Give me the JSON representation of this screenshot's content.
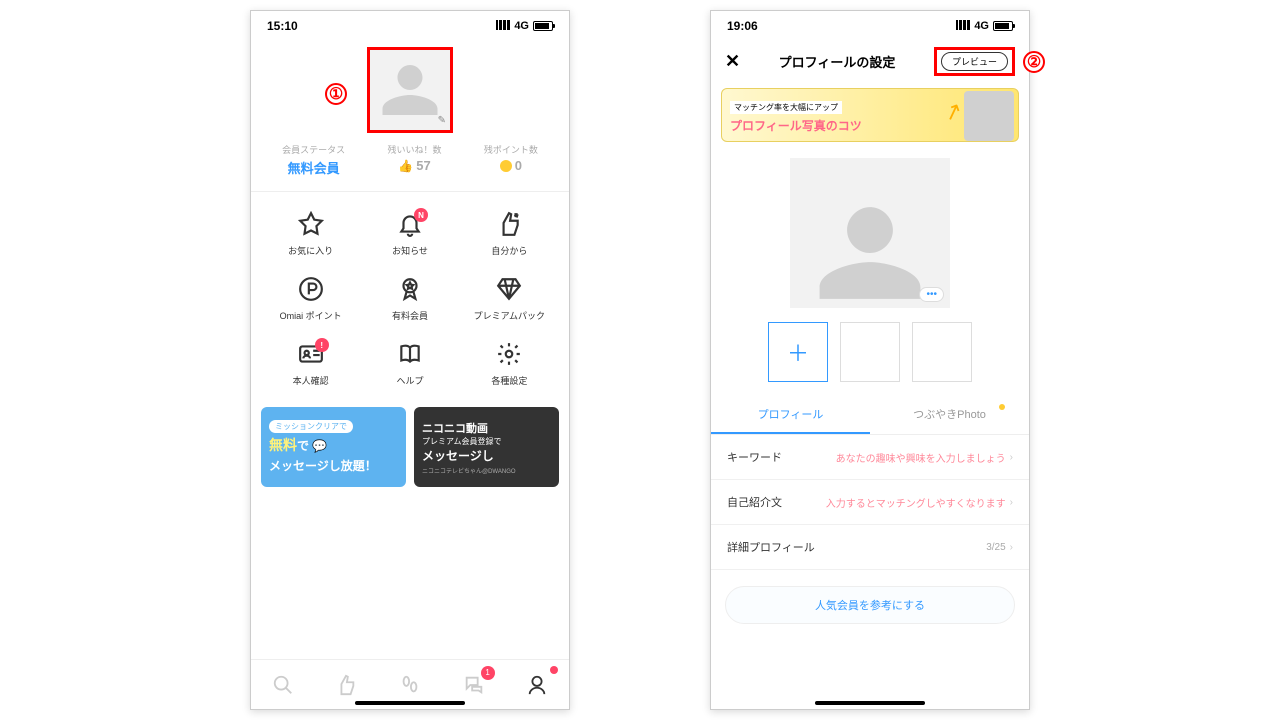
{
  "screen1": {
    "time": "15:10",
    "network": "4G",
    "annotation": "①",
    "stats": {
      "status_label": "会員ステータス",
      "status_value": "無料会員",
      "likes_label": "残いいね！数",
      "likes_value": "57",
      "points_label": "残ポイント数",
      "points_value": "0"
    },
    "menu": [
      {
        "label": "お気に入り",
        "icon": "star"
      },
      {
        "label": "お知らせ",
        "icon": "bell",
        "badge": "N"
      },
      {
        "label": "自分から",
        "icon": "thumbs-up-arrow"
      },
      {
        "label": "Omiai ポイント",
        "icon": "circle-p"
      },
      {
        "label": "有料会員",
        "icon": "medal"
      },
      {
        "label": "プレミアムパック",
        "icon": "diamond"
      },
      {
        "label": "本人確認",
        "icon": "id-card",
        "badge": "!"
      },
      {
        "label": "ヘルプ",
        "icon": "book"
      },
      {
        "label": "各種設定",
        "icon": "gear"
      }
    ],
    "banner1": {
      "pill": "ミッションクリアで",
      "line1_a": "無料",
      "line1_b": "で",
      "line2": "メッセージし放題！"
    },
    "banner2": {
      "t1": "ニコニコ動画",
      "t2": "プレミアム会員登録で",
      "t3": "メッセージし",
      "small": "ニコニコテレビちゃん@DWANGO"
    },
    "tabbar_badge_chat": "1"
  },
  "screen2": {
    "time": "19:06",
    "network": "4G",
    "annotation": "②",
    "title": "プロフィールの設定",
    "preview_btn": "プレビュー",
    "promo": {
      "p1": "マッチング率を大幅にアップ",
      "p2": "プロフィール写真のコツ"
    },
    "tabs": {
      "profile": "プロフィール",
      "photo": "つぶやきPhoto"
    },
    "rows": {
      "keyword_label": "キーワード",
      "keyword_hint": "あなたの趣味や興味を入力しましょう",
      "intro_label": "自己紹介文",
      "intro_hint": "入力するとマッチングしやすくなります",
      "detail_label": "詳細プロフィール",
      "detail_value": "3/25"
    },
    "ref_button": "人気会員を参考にする"
  }
}
